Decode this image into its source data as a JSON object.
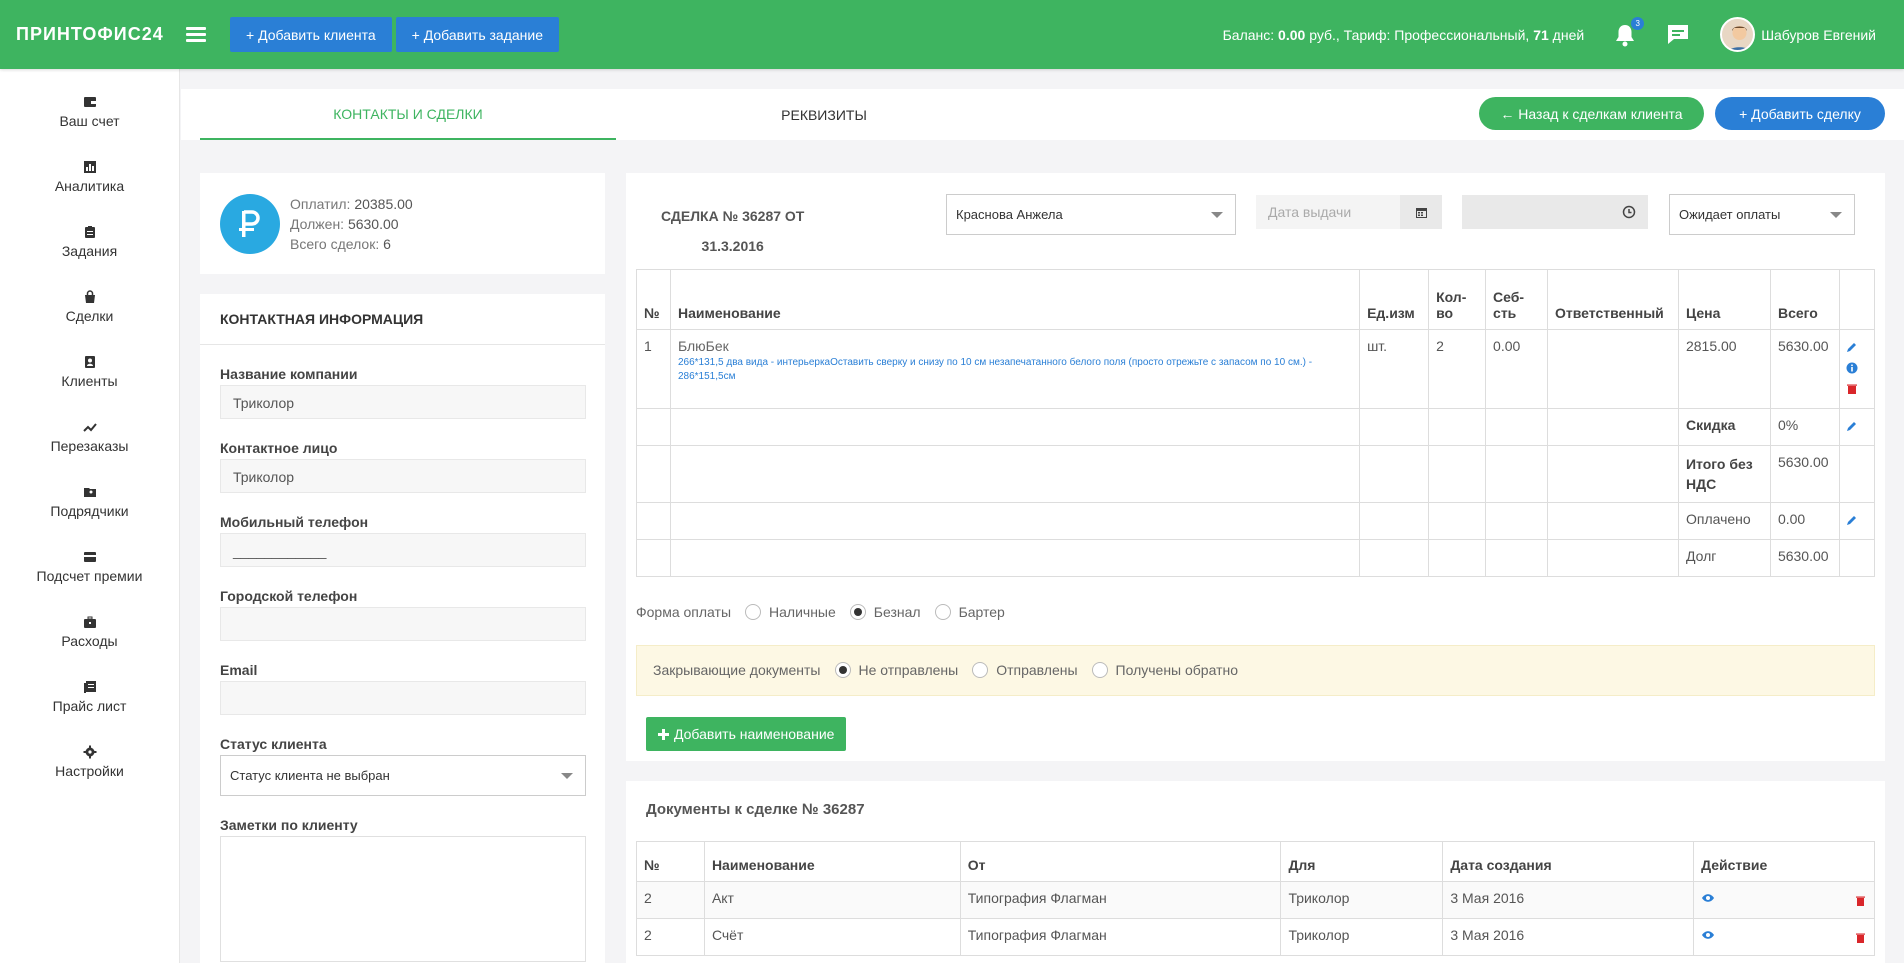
{
  "header": {
    "logo": "ПРИНТОФИС24",
    "add_client": "+ Добавить клиента",
    "add_task": "+ Добавить задание",
    "balance_prefix": "Баланс:",
    "balance_value": "0.00",
    "balance_mid": "руб., Тариф: Профессиональный,",
    "balance_days": "71",
    "balance_suffix": "дней",
    "notif_count": "3",
    "user_name": "Шабуров Евгений"
  },
  "sidebar": [
    {
      "label": "Ваш счет",
      "icon": "wallet-icon"
    },
    {
      "label": "Аналитика",
      "icon": "bar-chart-icon"
    },
    {
      "label": "Задания",
      "icon": "clipboard-icon"
    },
    {
      "label": "Сделки",
      "icon": "bag-icon"
    },
    {
      "label": "Клиенты",
      "icon": "contacts-icon"
    },
    {
      "label": "Перезаказы",
      "icon": "trend-icon"
    },
    {
      "label": "Подрядчики",
      "icon": "folder-user-icon"
    },
    {
      "label": "Подсчет премии",
      "icon": "credit-card-icon"
    },
    {
      "label": "Расходы",
      "icon": "briefcase-icon"
    },
    {
      "label": "Прайс лист",
      "icon": "list-icon"
    },
    {
      "label": "Настройки",
      "icon": "gear-icon"
    }
  ],
  "tabs": {
    "contacts": "КОНТАКТЫ И СДЕЛКИ",
    "requisites": "РЕКВИЗИТЫ",
    "back": "← Назад к сделкам клиента",
    "add_deal": "+ Добавить сделку"
  },
  "summary": {
    "paid_label": "Оплатил:",
    "paid_value": "20385.00",
    "owes_label": "Должен:",
    "owes_value": "5630.00",
    "total_label": "Всего сделок:",
    "total_value": "6"
  },
  "contact": {
    "title": "КОНТАКТНАЯ ИНФОРМАЦИЯ",
    "company_label": "Название компании",
    "company_value": "Триколор",
    "person_label": "Контактное лицо",
    "person_value": "Триколор",
    "mobile_label": "Мобильный телефон",
    "mobile_value": "____________",
    "city_label": "Городской телефон",
    "city_value": "",
    "email_label": "Email",
    "email_value": "",
    "status_label": "Статус клиента",
    "status_value": "Статус клиента не выбран",
    "notes_label": "Заметки по клиенту"
  },
  "deal": {
    "title_line1": "СДЕЛКА № 36287 ОТ",
    "title_line2": "31.3.2016",
    "manager": "Краснова Анжела",
    "date_placeholder": "Дата выдачи",
    "status": "Ожидает оплаты",
    "columns": [
      "№",
      "Наименование",
      "Ед.изм",
      "Кол-во",
      "Себ-сть",
      "Ответственный",
      "Цена",
      "Всего"
    ],
    "item": {
      "num": "1",
      "name": "БлюБек",
      "desc": "266*131,5 два вида - интерьеркаОставить сверку и снизу по 10 см незапечатанного белого поля (просто отрежьте с запасом по 10 см.) - 286*151,5см",
      "unit": "шт.",
      "qty": "2",
      "cost": "0.00",
      "resp": "",
      "price": "2815.00",
      "total": "5630.00"
    },
    "discount_label": "Скидка",
    "discount_value": "0%",
    "nonds_label": "Итого без НДС",
    "nonds_value": "5630.00",
    "paid_label": "Оплачено",
    "paid_value": "0.00",
    "debt_label": "Долг",
    "debt_value": "5630.00",
    "payment_label": "Форма оплаты",
    "payment_options": [
      "Наличные",
      "Безнал",
      "Бартер"
    ],
    "payment_selected": "Безнал",
    "closing_label": "Закрывающие документы",
    "closing_options": [
      "Не отправлены",
      "Отправлены",
      "Получены обратно"
    ],
    "closing_selected": "Не отправлены",
    "add_item": "Добавить наименование"
  },
  "docs": {
    "title": "Документы к сделке № 36287",
    "columns": [
      "№",
      "Наименование",
      "От",
      "Для",
      "Дата создания",
      "Действие"
    ],
    "rows": [
      {
        "num": "2",
        "name": "Акт",
        "from": "Типография Флагман",
        "to": "Триколор",
        "date": "3 Мая 2016"
      },
      {
        "num": "2",
        "name": "Счёт",
        "from": "Типография Флагман",
        "to": "Триколор",
        "date": "3 Мая 2016"
      }
    ]
  },
  "colors": {
    "green": "#3eb460",
    "blue": "#2a7fd6",
    "cyan": "#29a9e1",
    "red": "#d9262a"
  }
}
